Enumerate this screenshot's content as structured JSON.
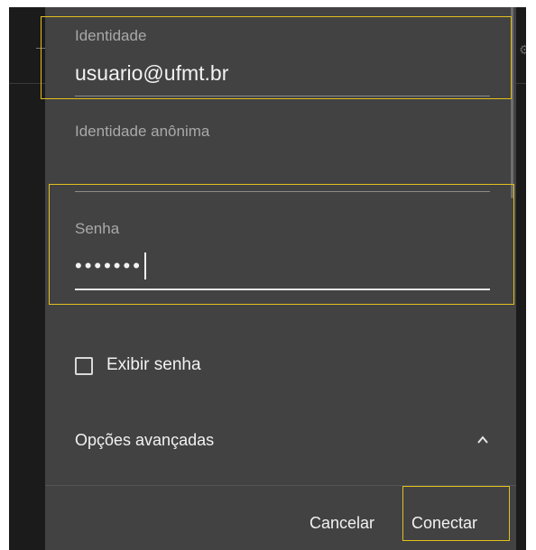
{
  "dialog": {
    "identity_label": "Identidade",
    "identity_value": "usuario@ufmt.br",
    "anonymous_identity_label": "Identidade anônima",
    "anonymous_identity_value": "",
    "password_label": "Senha",
    "password_value": "•••••••",
    "show_password_label": "Exibir senha",
    "show_password_checked": false,
    "advanced_options_label": "Opções avançadas",
    "cancel_label": "Cancelar",
    "connect_label": "Conectar"
  },
  "colors": {
    "dialog_bg": "#424242",
    "screen_bg": "#1b1b1b",
    "highlight": "#e3c01e",
    "text": "#f2f2f2",
    "label": "#a9a9a9"
  }
}
